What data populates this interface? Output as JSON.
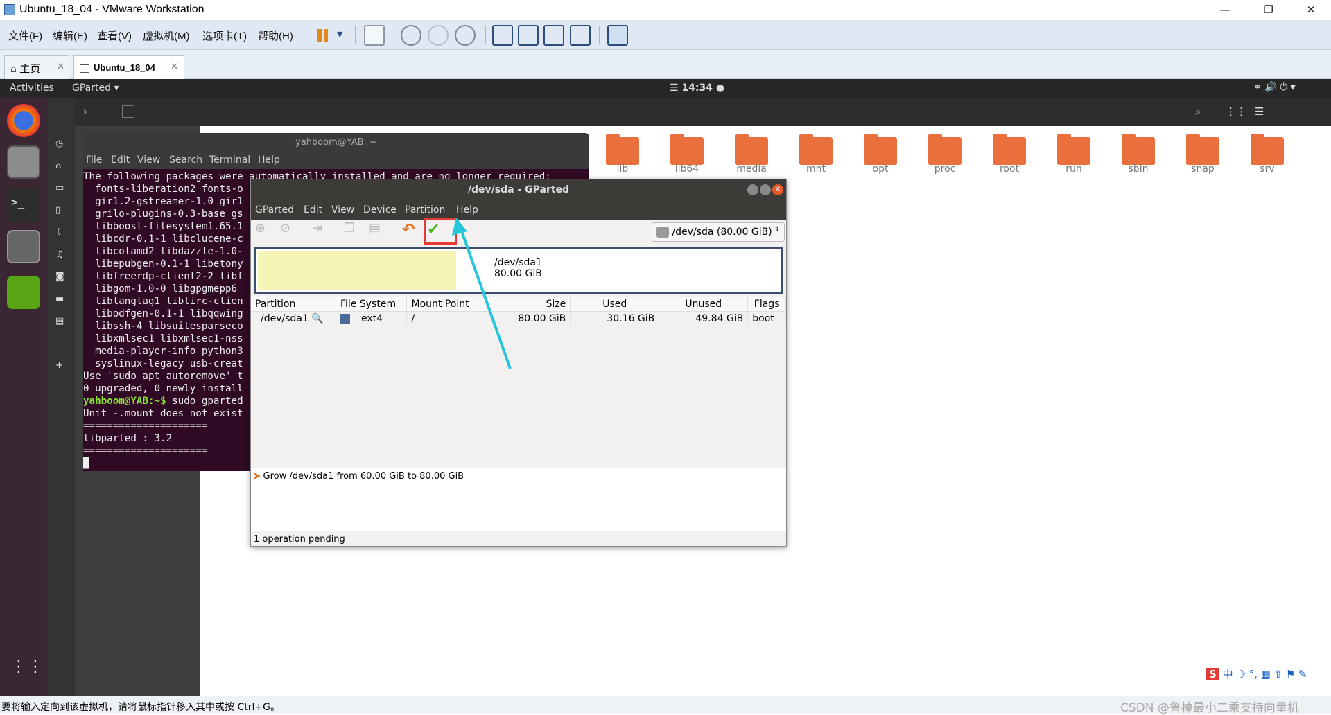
{
  "window": {
    "title": "Ubuntu_18_04 - VMware Workstation"
  },
  "vmware_menu": [
    "文件(F)",
    "编辑(E)",
    "查看(V)",
    "虚拟机(M)",
    "选项卡(T)",
    "帮助(H)"
  ],
  "tabs": [
    {
      "label": "主页"
    },
    {
      "label": "Ubuntu_18_04"
    }
  ],
  "ubuntu": {
    "activities": "Activities",
    "app_menu": "GParted",
    "clock": "14:34"
  },
  "folders": [
    "lib",
    "lib64",
    "media",
    "mnt",
    "opt",
    "proc",
    "root",
    "run",
    "sbin",
    "snap",
    "srv"
  ],
  "terminal": {
    "title": "yahboom@YAB: ~",
    "menu": [
      "File",
      "Edit",
      "View",
      "Search",
      "Terminal",
      "Help"
    ],
    "lines": [
      "The following packages were automatically installed and are no longer required:",
      "  fonts-liberation2 fonts-o",
      "  gir1.2-gstreamer-1.0 gir1",
      "  grilo-plugins-0.3-base gs",
      "  libboost-filesystem1.65.1",
      "  libcdr-0.1-1 libclucene-c",
      "  libcolamd2 libdazzle-1.0-",
      "  libepubgen-0.1-1 libetony",
      "  libfreerdp-client2-2 libf",
      "  libgom-1.0-0 libgpgmepp6",
      "  liblangtag1 liblirc-clien",
      "  libodfgen-0.1-1 libqqwing",
      "  libssh-4 libsuitesparseco",
      "  libxmlsec1 libxmlsec1-nss",
      "  media-player-info python3",
      "  syslinux-legacy usb-creat",
      "Use 'sudo apt autoremove' t",
      "0 upgraded, 0 newly install"
    ],
    "prompt": "yahboom@YAB:~$",
    "command": " sudo gparted",
    "lines2": [
      "Unit -.mount does not exist",
      "=====================",
      "libparted : 3.2",
      "====================="
    ]
  },
  "gparted": {
    "title": "/dev/sda - GParted",
    "menu": [
      "GParted",
      "Edit",
      "View",
      "Device",
      "Partition",
      "Help"
    ],
    "device": "/dev/sda",
    "device_size": "(80.00 GiB)",
    "map_name": "/dev/sda1",
    "map_size": "80.00 GiB",
    "used_fraction": 0.377,
    "columns": [
      "Partition",
      "File System",
      "Mount Point",
      "Size",
      "Used",
      "Unused",
      "Flags"
    ],
    "rows": [
      {
        "partition": "/dev/sda1",
        "fs": "ext4",
        "mount": "/",
        "size": "80.00 GiB",
        "used": "30.16 GiB",
        "unused": "49.84 GiB",
        "flags": "boot"
      }
    ],
    "operation": "Grow /dev/sda1 from 60.00 GiB to 80.00 GiB",
    "status": "1 operation pending",
    "fs_color": "#4a6b9a"
  },
  "statusbar": {
    "text": "要将输入定向到该虚拟机，请将鼠标指针移入其中或按 Ctrl+G。",
    "watermark": "CSDN @鲁棒最小二乘支持向量机"
  },
  "colors": {
    "highlight": "#e53935",
    "arrow": "#26c6da",
    "folder": "#e96f3c"
  }
}
